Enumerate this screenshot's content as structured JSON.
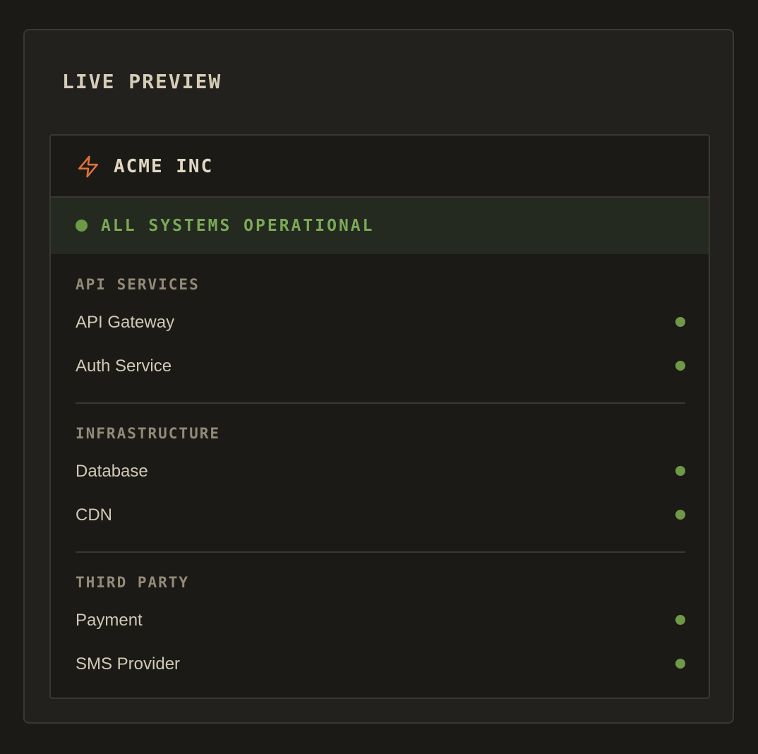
{
  "panel": {
    "title": "LIVE PREVIEW"
  },
  "header": {
    "icon": "lightning-bolt-icon",
    "company_name": "ACME INC"
  },
  "status_banner": {
    "text": "ALL SYSTEMS OPERATIONAL"
  },
  "groups": [
    {
      "name": "API SERVICES",
      "services": [
        {
          "name": "API Gateway"
        },
        {
          "name": "Auth Service"
        }
      ]
    },
    {
      "name": "INFRASTRUCTURE",
      "services": [
        {
          "name": "Database"
        },
        {
          "name": "CDN"
        }
      ]
    },
    {
      "name": "THIRD PARTY",
      "services": [
        {
          "name": "Payment"
        },
        {
          "name": "SMS Provider"
        }
      ]
    }
  ],
  "colors": {
    "page_background": "#1b1a17",
    "panel_background": "#23211d",
    "border": "#3b3833",
    "accent_orange": "#e0713a",
    "operational_green": "#6e9a48",
    "banner_background": "#242a20"
  }
}
